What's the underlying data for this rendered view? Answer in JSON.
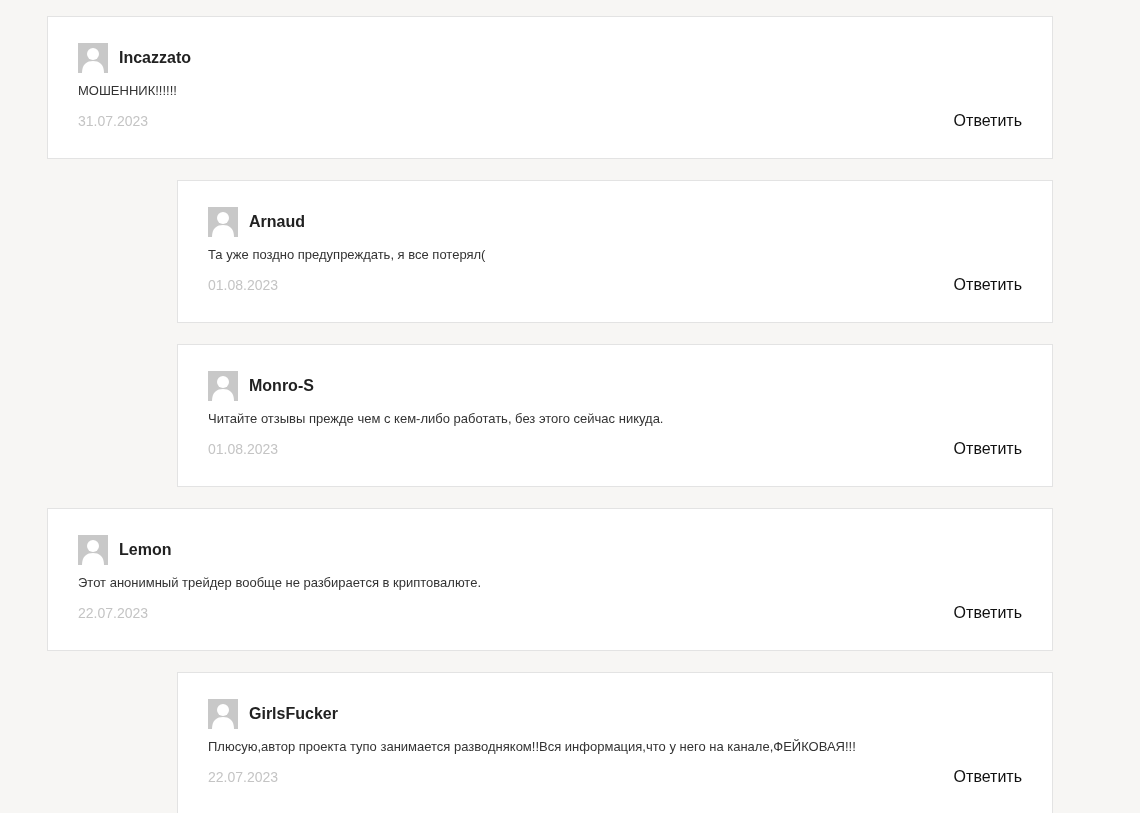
{
  "comments": [
    {
      "author": "Incazzato",
      "text": "МОШЕННИК!!!!!!",
      "date": "31.07.2023",
      "reply": "Ответить",
      "children": [
        {
          "author": "Arnaud",
          "text": "Та уже поздно предупреждать, я все потерял(",
          "date": "01.08.2023",
          "reply": "Ответить"
        },
        {
          "author": "Monro-S",
          "text": "Читайте отзывы прежде чем с кем-либо работать, без этого сейчас никуда.",
          "date": "01.08.2023",
          "reply": "Ответить"
        }
      ]
    },
    {
      "author": "Lemon",
      "text": "Этот анонимный трейдер вообще не разбирается в криптовалюте.",
      "date": "22.07.2023",
      "reply": "Ответить",
      "children": [
        {
          "author": "GirlsFucker",
          "text": "Плюсую,автор проекта тупо занимается разводняком!!Вся информация,что у него на канале,ФЕЙКОВАЯ!!!",
          "date": "22.07.2023",
          "reply": "Ответить"
        }
      ]
    }
  ]
}
